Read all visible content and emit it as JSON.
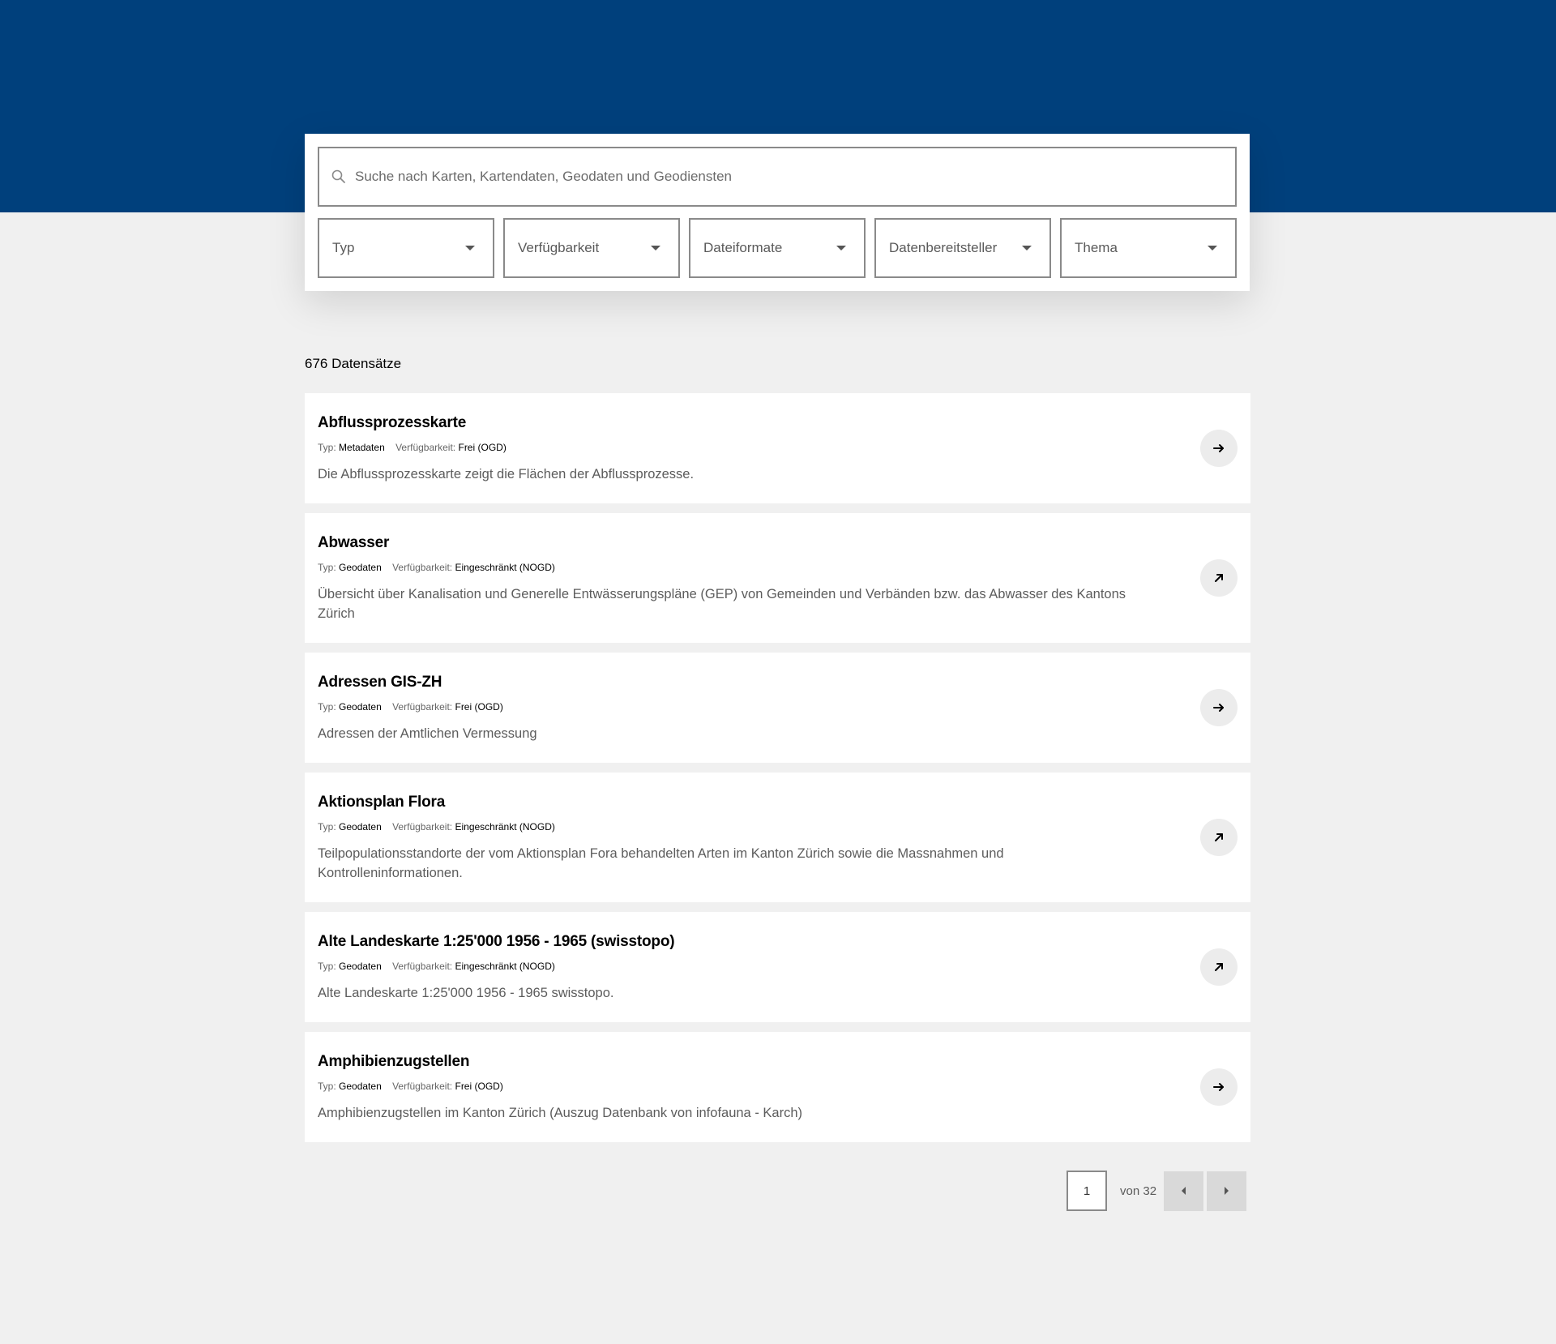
{
  "colors": {
    "header_blue": "#00407c",
    "page_bg": "#f0f0f0"
  },
  "search": {
    "placeholder": "Suche nach Karten, Kartendaten, Geodaten und Geodiensten",
    "icon": "search-icon"
  },
  "filters": [
    {
      "label": "Typ"
    },
    {
      "label": "Verfügbarkeit"
    },
    {
      "label": "Dateiformate"
    },
    {
      "label": "Datenbereitsteller"
    },
    {
      "label": "Thema"
    }
  ],
  "results_count": "676 Datensätze",
  "meta_labels": {
    "type": "Typ:",
    "availability": "Verfügbarkeit:"
  },
  "results": [
    {
      "title": "Abflussprozesskarte",
      "type": "Metadaten",
      "availability": "Frei (OGD)",
      "description": "Die Abflussprozesskarte zeigt die Flächen der Abflussprozesse.",
      "icon": "arrow-right-icon"
    },
    {
      "title": "Abwasser",
      "type": "Geodaten",
      "availability": "Eingeschränkt (NOGD)",
      "description": "Übersicht über Kanalisation und Generelle Entwässerungspläne (GEP) von Gemeinden und Verbänden bzw. das Abwasser des Kantons Zürich",
      "icon": "arrow-up-right-icon"
    },
    {
      "title": "Adressen GIS-ZH",
      "type": "Geodaten",
      "availability": "Frei (OGD)",
      "description": "Adressen der Amtlichen Vermessung",
      "icon": "arrow-right-icon"
    },
    {
      "title": "Aktionsplan Flora",
      "type": "Geodaten",
      "availability": "Eingeschränkt (NOGD)",
      "description": "Teilpopulationsstandorte der vom Aktionsplan Fora behandelten Arten im Kanton Zürich sowie die Massnahmen und Kontrolleninformationen.",
      "icon": "arrow-up-right-icon"
    },
    {
      "title": "Alte Landeskarte 1:25'000 1956 - 1965 (swisstopo)",
      "type": "Geodaten",
      "availability": "Eingeschränkt (NOGD)",
      "description": "Alte Landeskarte 1:25'000 1956 - 1965 swisstopo.",
      "icon": "arrow-up-right-icon"
    },
    {
      "title": "Amphibienzugstellen",
      "type": "Geodaten",
      "availability": "Frei (OGD)",
      "description": "Amphibienzugstellen im Kanton Zürich (Auszug Datenbank von infofauna - Karch)",
      "icon": "arrow-right-icon"
    }
  ],
  "pagination": {
    "current": "1",
    "of_label": "von 32"
  }
}
